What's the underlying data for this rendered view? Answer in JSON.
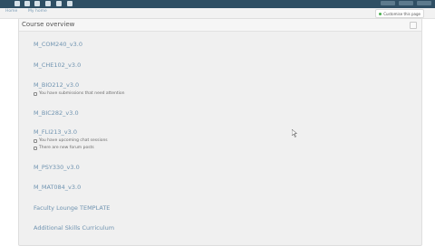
{
  "header": {
    "breadcrumb": [
      "Home",
      "My home"
    ],
    "status": "Customise this page"
  },
  "block": {
    "title": "Course overview",
    "courses": [
      {
        "name": "M_COM240_v3.0",
        "notices": []
      },
      {
        "name": "M_CHE102_v3.0",
        "notices": []
      },
      {
        "name": "M_BIO212_v3.0",
        "notices": [
          "You have submissions that need attention"
        ]
      },
      {
        "name": "M_BIC282_v3.0",
        "notices": []
      },
      {
        "name": "M_FLI213_v3.0",
        "notices": [
          "You have upcoming chat sessions",
          "There are new forum posts"
        ]
      },
      {
        "name": "M_PSY330_v3.0",
        "notices": []
      },
      {
        "name": "M_MAT084_v3.0",
        "notices": []
      },
      {
        "name": "Faculty Lounge TEMPLATE",
        "notices": []
      },
      {
        "name": "Additional Skills Curriculum",
        "notices": []
      }
    ]
  },
  "colors": {
    "topbar": "#2f4f64",
    "link": "#6f93b0",
    "panel": "#f0f0f0"
  }
}
